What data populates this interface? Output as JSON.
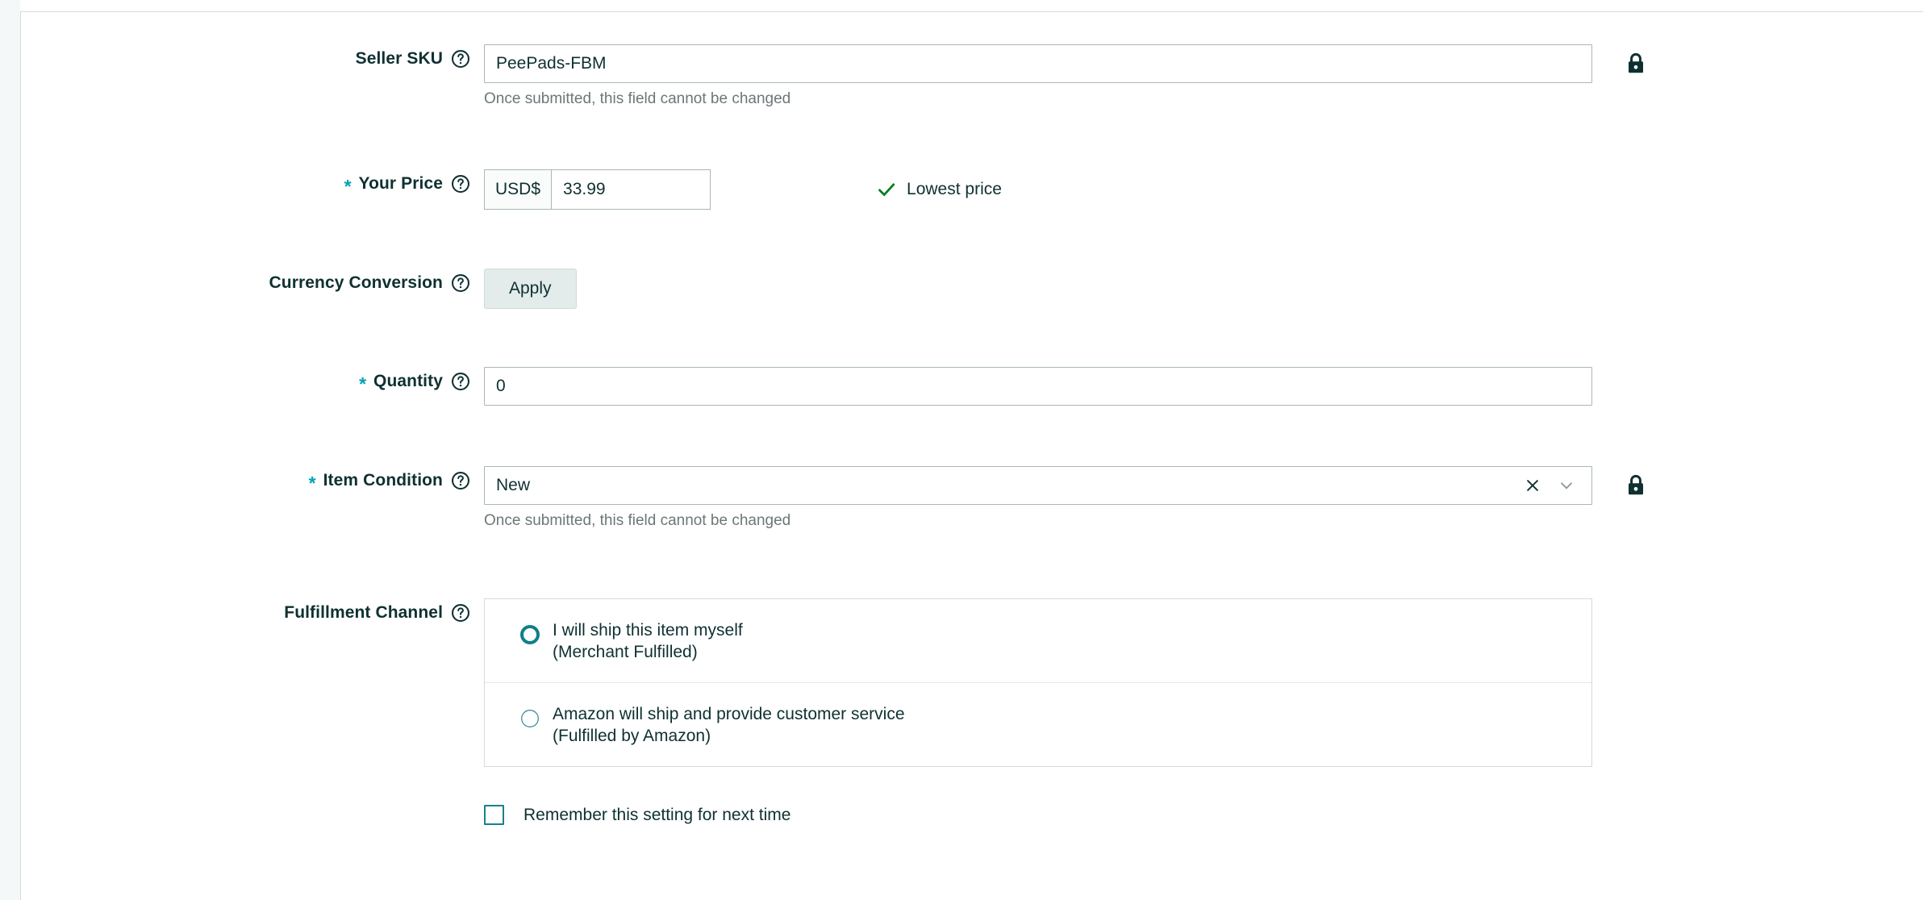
{
  "form": {
    "rows": [
      {
        "label": "Seller SKU",
        "required": false,
        "help_icon": "help-circle-icon",
        "value": "PeePads-FBM",
        "hint": "Once submitted, this field cannot be changed",
        "locked": true,
        "lock_icon": "lock-icon"
      },
      {
        "label": "Your Price",
        "required": true,
        "help_icon": "help-circle-icon",
        "currency_prefix": "USD$",
        "value": "33.99",
        "status_icon": "check-icon",
        "status_text": "Lowest price"
      },
      {
        "label": "Currency Conversion",
        "required": false,
        "help_icon": "help-circle-icon",
        "button_label": "Apply"
      },
      {
        "label": "Quantity",
        "required": true,
        "help_icon": "help-circle-icon",
        "value": "0"
      },
      {
        "label": "Item Condition",
        "required": true,
        "help_icon": "help-circle-icon",
        "value": "New",
        "clear_icon": "close-icon",
        "chevron_icon": "chevron-down-icon",
        "hint": "Once submitted, this field cannot be changed",
        "locked": true,
        "lock_icon": "lock-icon"
      },
      {
        "label": "Fulfillment Channel",
        "required": false,
        "help_icon": "help-circle-icon",
        "options": [
          {
            "main": "I will ship this item myself",
            "sub": "(Merchant Fulfilled)",
            "selected": true
          },
          {
            "main": "Amazon will ship and provide customer service",
            "sub": "(Fulfilled by Amazon)",
            "selected": false
          }
        ],
        "remember_label": "Remember this setting for next time",
        "remember_checked": false
      }
    ]
  },
  "colors": {
    "accent_teal": "#00a1b5",
    "radio_teal": "#107e8b",
    "text_dark": "#0f3031",
    "hint_gray": "#6c7778",
    "success_green": "#067d1e",
    "border_gray": "#aab7b8",
    "button_bg": "#e3ebeb",
    "gutter_bg": "#f4f8f8"
  }
}
